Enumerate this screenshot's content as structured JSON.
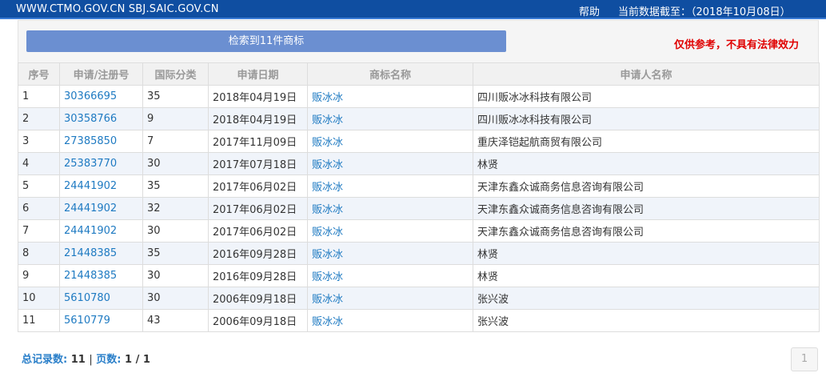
{
  "header": {
    "site": "WWW.CTMO.GOV.CN SBJ.SAIC.GOV.CN",
    "help": "帮助",
    "data_date": "当前数据截至：（2018年10月08日）"
  },
  "summary": {
    "result_text": "检索到11件商标",
    "disclaimer": "仅供参考，不具有法律效力"
  },
  "table": {
    "columns": [
      "序号",
      "申请/注册号",
      "国际分类",
      "申请日期",
      "商标名称",
      "申请人名称"
    ],
    "rows": [
      [
        "1",
        "30366695",
        "35",
        "2018年04月19日",
        "贩冰冰",
        "四川贩冰冰科技有限公司"
      ],
      [
        "2",
        "30358766",
        "9",
        "2018年04月19日",
        "贩冰冰",
        "四川贩冰冰科技有限公司"
      ],
      [
        "3",
        "27385850",
        "7",
        "2017年11月09日",
        "贩冰冰",
        "重庆泽铠起航商贸有限公司"
      ],
      [
        "4",
        "25383770",
        "30",
        "2017年07月18日",
        "贩冰冰",
        "林贤"
      ],
      [
        "5",
        "24441902",
        "35",
        "2017年06月02日",
        "贩冰冰",
        "天津东鑫众诚商务信息咨询有限公司"
      ],
      [
        "6",
        "24441902",
        "32",
        "2017年06月02日",
        "贩冰冰",
        "天津东鑫众诚商务信息咨询有限公司"
      ],
      [
        "7",
        "24441902",
        "30",
        "2017年06月02日",
        "贩冰冰",
        "天津东鑫众诚商务信息咨询有限公司"
      ],
      [
        "8",
        "21448385",
        "35",
        "2016年09月28日",
        "贩冰冰",
        "林贤"
      ],
      [
        "9",
        "21448385",
        "30",
        "2016年09月28日",
        "贩冰冰",
        "林贤"
      ],
      [
        "10",
        "5610780",
        "30",
        "2006年09月18日",
        "贩冰冰",
        "张兴波"
      ],
      [
        "11",
        "5610779",
        "43",
        "2006年09月18日",
        "贩冰冰",
        "张兴波"
      ]
    ]
  },
  "footer": {
    "total_label": "总记录数:",
    "total_value": "11",
    "separator": "|",
    "pages_label": "页数:",
    "pages_value": "1 / 1",
    "page_button": "1"
  },
  "colors": {
    "header_bg": "#0f4ea1",
    "result_bar_bg": "#6b8fd1",
    "link": "#1e7ac2",
    "disclaimer": "#e00000"
  }
}
